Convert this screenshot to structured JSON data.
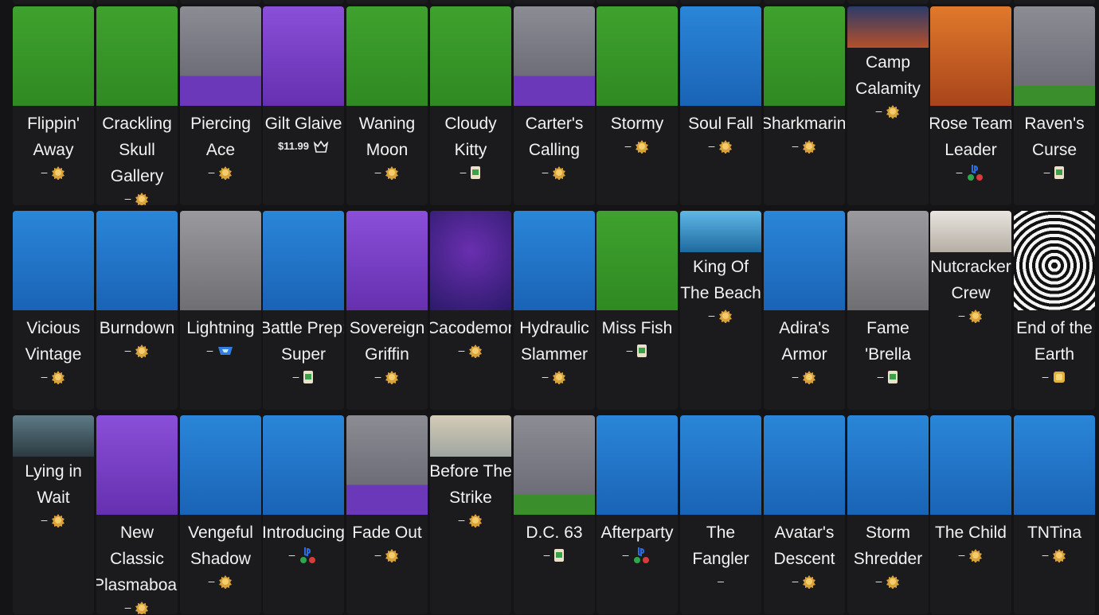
{
  "colors": {
    "green": "#3f9f2c",
    "blue": "#1e74c8",
    "purple": "#7a3fc8",
    "gray": "#8a8a8e",
    "card_bg": "#1b1b1e",
    "page_bg": "#141416"
  },
  "rows": [
    [
      {
        "name": "Flippin' Away",
        "bg": "green",
        "meta": "–",
        "icon": "battle-pass-icon"
      },
      {
        "name": "Crackling Skull Gallery",
        "bg": "green",
        "meta": "–",
        "icon": "battle-pass-icon"
      },
      {
        "name": "Piercing Ace",
        "bg": "brick-purple",
        "meta": "–",
        "icon": "battle-pass-icon"
      },
      {
        "name": "Gilt Glaive",
        "bg": "purple",
        "meta": "$11.99",
        "icon": "crown-icon"
      },
      {
        "name": "Waning Moon",
        "bg": "green",
        "meta": "–",
        "icon": "battle-pass-icon"
      },
      {
        "name": "Cloudy Kitty",
        "bg": "green",
        "meta": "–",
        "icon": "code-card-icon"
      },
      {
        "name": "Carter's Calling",
        "bg": "brick-purple",
        "meta": "–",
        "icon": "battle-pass-icon"
      },
      {
        "name": "Stormy",
        "bg": "green",
        "meta": "–",
        "icon": "battle-pass-icon"
      },
      {
        "name": "Soul Fall",
        "bg": "blue",
        "meta": "–",
        "icon": "battle-pass-icon"
      },
      {
        "name": "Sharkmarine",
        "bg": "green",
        "meta": "–",
        "icon": "battle-pass-icon"
      },
      {
        "name": "Camp Calamity",
        "bg": "photo",
        "meta": "–",
        "icon": "battle-pass-icon",
        "short": true
      },
      {
        "name": "Rose Team Leader",
        "bg": "orange",
        "meta": "–",
        "icon": "console-bundle-icon"
      },
      {
        "name": "Raven's Curse",
        "bg": "brick-green",
        "meta": "–",
        "icon": "code-card-icon"
      }
    ],
    [
      {
        "name": "Vicious Vintage",
        "bg": "blue",
        "meta": "–",
        "icon": "battle-pass-icon"
      },
      {
        "name": "Burndown",
        "bg": "blue",
        "meta": "–",
        "icon": "battle-pass-icon"
      },
      {
        "name": "Lightning",
        "bg": "gray",
        "meta": "–",
        "icon": "rocket-league-icon"
      },
      {
        "name": "Battle Prep: Super",
        "bg": "blue",
        "meta": "–",
        "icon": "code-card-icon"
      },
      {
        "name": "Sovereign Griffin",
        "bg": "purple",
        "meta": "–",
        "icon": "battle-pass-icon"
      },
      {
        "name": "Cacodemon",
        "bg": "violet",
        "meta": "–",
        "icon": "battle-pass-icon"
      },
      {
        "name": "Hydraulic Slammer",
        "bg": "blue",
        "meta": "–",
        "icon": "battle-pass-icon"
      },
      {
        "name": "Miss Fish",
        "bg": "green",
        "meta": "–",
        "icon": "code-card-icon"
      },
      {
        "name": "King Of The Beach",
        "bg": "photo-sea",
        "meta": "–",
        "icon": "battle-pass-icon",
        "short": true
      },
      {
        "name": "Adira's Armor",
        "bg": "blue",
        "meta": "–",
        "icon": "battle-pass-icon"
      },
      {
        "name": "Fame 'Brella",
        "bg": "gray",
        "meta": "–",
        "icon": "code-card-icon"
      },
      {
        "name": "Nutcracker Crew",
        "bg": "photo-light",
        "meta": "–",
        "icon": "battle-pass-icon",
        "short": true
      },
      {
        "name": "End of the Earth",
        "bg": "spiral",
        "meta": "–",
        "icon": "gold-pass-icon"
      }
    ],
    [
      {
        "name": "Lying in Wait",
        "bg": "photo-dark",
        "meta": "–",
        "icon": "battle-pass-icon",
        "short": true
      },
      {
        "name": "New Classic Plasmaboard",
        "bg": "purple",
        "meta": "–",
        "icon": "battle-pass-icon"
      },
      {
        "name": "Vengeful Shadow",
        "bg": "blue",
        "meta": "–",
        "icon": "battle-pass-icon"
      },
      {
        "name": "Introducing",
        "bg": "blue",
        "meta": "–",
        "icon": "console-bundle-icon"
      },
      {
        "name": "Fade Out",
        "bg": "brick-purple",
        "meta": "–",
        "icon": "battle-pass-icon"
      },
      {
        "name": "Before The Strike",
        "bg": "photo-map",
        "meta": "–",
        "icon": "battle-pass-icon",
        "short": true
      },
      {
        "name": "D.C. 63",
        "bg": "brick-green",
        "meta": "–",
        "icon": "code-card-icon"
      },
      {
        "name": "Afterparty",
        "bg": "blue",
        "meta": "–",
        "icon": "console-bundle-icon"
      },
      {
        "name": "The Fangler",
        "bg": "blue",
        "meta": "–",
        "icon": ""
      },
      {
        "name": "Avatar's Descent",
        "bg": "blue",
        "meta": "–",
        "icon": "battle-pass-icon"
      },
      {
        "name": "Storm Shredder",
        "bg": "blue",
        "meta": "–",
        "icon": "battle-pass-icon"
      },
      {
        "name": "The Child",
        "bg": "blue",
        "meta": "–",
        "icon": "battle-pass-icon"
      },
      {
        "name": "TNTina",
        "bg": "blue",
        "meta": "–",
        "icon": "battle-pass-icon"
      }
    ]
  ]
}
